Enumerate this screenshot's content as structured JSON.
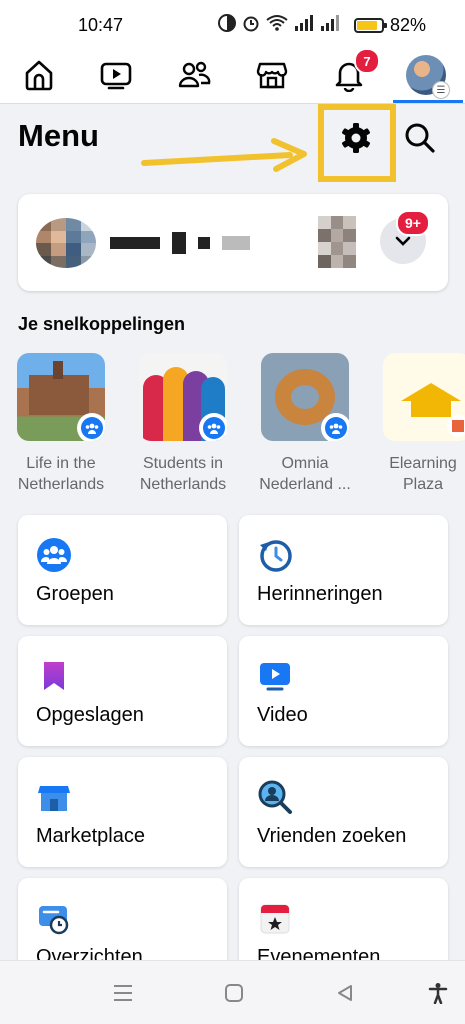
{
  "status_bar": {
    "time": "10:47",
    "battery_percent": "82%",
    "battery_level": 0.78
  },
  "nav": {
    "tabs": [
      {
        "name": "home-icon"
      },
      {
        "name": "video-icon"
      },
      {
        "name": "friends-icon"
      },
      {
        "name": "marketplace-icon"
      },
      {
        "name": "notifications-icon",
        "badge": "7"
      },
      {
        "name": "profile-menu-avatar"
      }
    ],
    "active_tab": "profile-menu-avatar"
  },
  "header": {
    "title": "Menu"
  },
  "profile_card": {
    "badge": "9+"
  },
  "shortcuts": {
    "title": "Je snelkoppelingen",
    "items": [
      {
        "label_line1": "Life in the",
        "label_line2": "Netherlands"
      },
      {
        "label_line1": "Students in",
        "label_line2": "Netherlands"
      },
      {
        "label_line1": "Omnia",
        "label_line2": "Nederland ..."
      },
      {
        "label_line1": "Elearning",
        "label_line2": "Plaza"
      }
    ]
  },
  "menu_tiles": [
    {
      "label": "Groepen",
      "icon": "groups-icon"
    },
    {
      "label": "Herinneringen",
      "icon": "memories-icon"
    },
    {
      "label": "Opgeslagen",
      "icon": "saved-icon"
    },
    {
      "label": "Video",
      "icon": "video-icon"
    },
    {
      "label": "Marketplace",
      "icon": "marketplace-icon"
    },
    {
      "label": "Vrienden zoeken",
      "icon": "find-friends-icon"
    },
    {
      "label": "Overzichten",
      "icon": "feeds-icon"
    },
    {
      "label": "Evenementen",
      "icon": "events-icon"
    }
  ],
  "colors": {
    "brand": "#1877f2",
    "badge": "#e41e3f",
    "highlight": "#f2c12e"
  }
}
